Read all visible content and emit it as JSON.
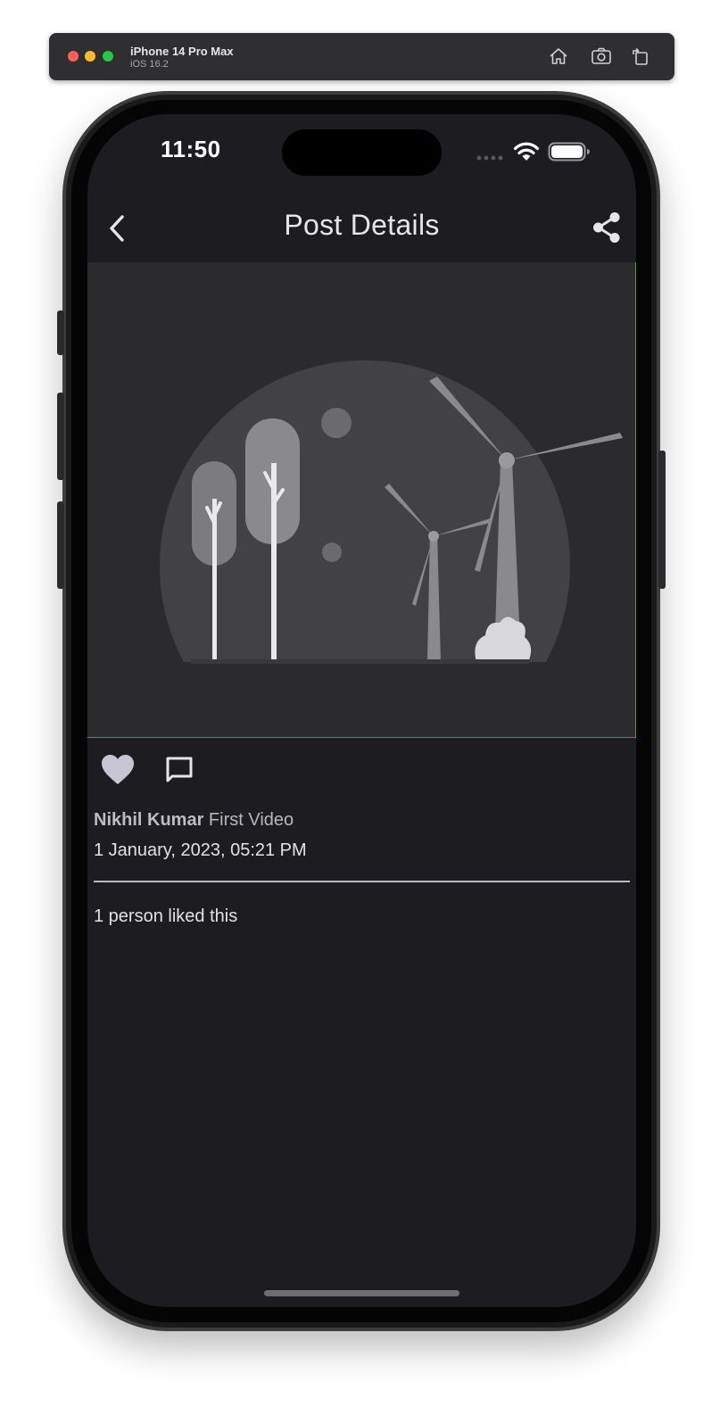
{
  "simulator": {
    "device_name": "iPhone 14 Pro Max",
    "os_version": "iOS 16.2",
    "buttons": [
      "home-icon",
      "screenshot-icon",
      "rotate-icon"
    ]
  },
  "status_bar": {
    "time": "11:50",
    "icons": [
      "signal-dots-icon",
      "wifi-icon",
      "battery-icon"
    ]
  },
  "app_bar": {
    "title": "Post Details",
    "back_icon": "chevron-left-icon",
    "share_icon": "share-icon"
  },
  "post": {
    "image_description_icon": "windmill-landscape-illustration",
    "like_icon": "heart-icon",
    "comment_icon": "comment-icon",
    "author": "Nikhil Kumar",
    "caption": "First Video",
    "timestamp": "1 January, 2023, 05:21 PM",
    "likes_text": "1 person liked this"
  },
  "colors": {
    "screen_bg": "#1d1c20",
    "image_bg": "#2b2b2d",
    "accent_border": "#3aa03a",
    "heart_fill": "#c9c4d4",
    "text_primary": "#e2e1e6"
  }
}
